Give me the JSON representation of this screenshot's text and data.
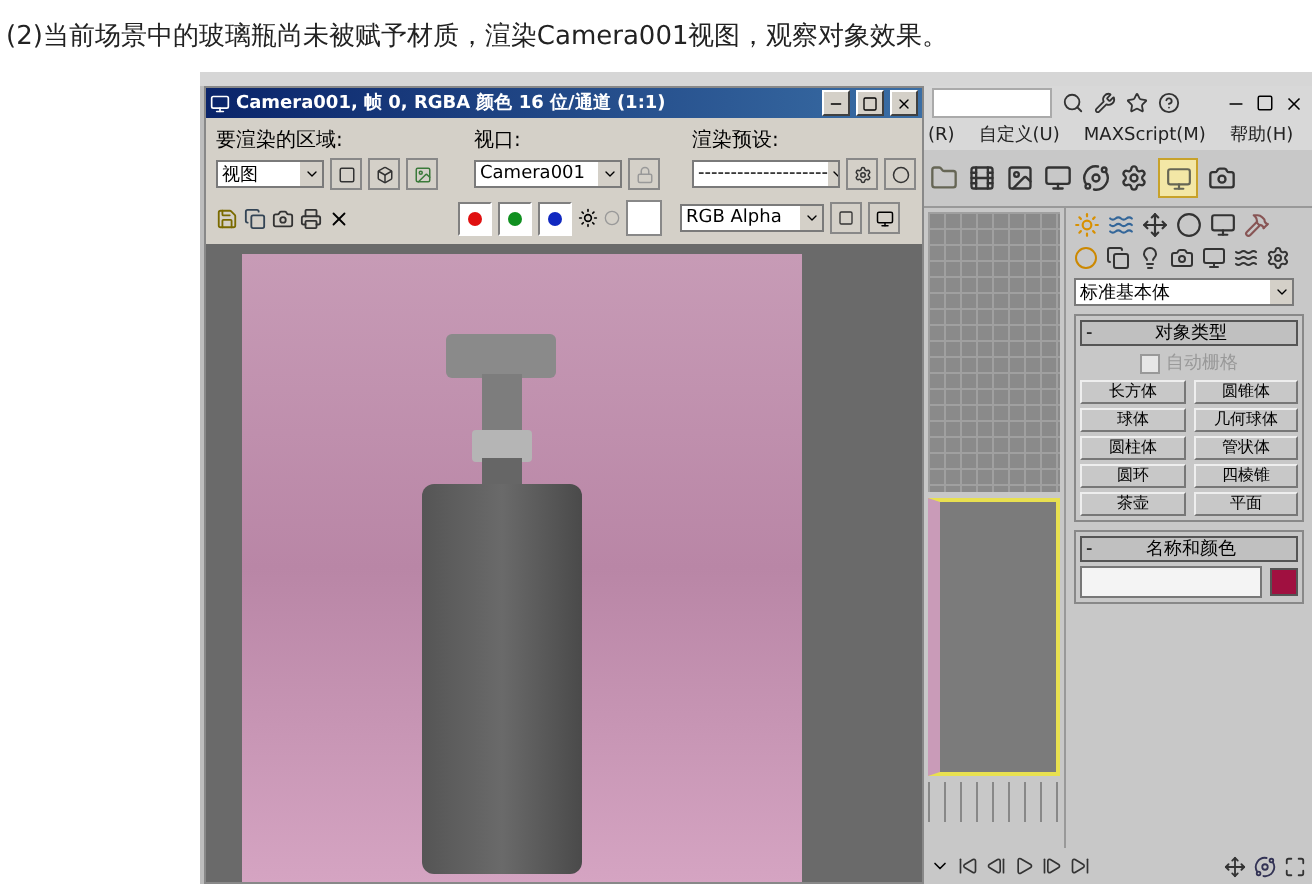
{
  "caption": "(2)当前场景中的玻璃瓶尚未被赋予材质，渲染Camera001视图，观察对象效果。",
  "render_window": {
    "title": "Camera001, 帧 0, RGBA 颜色 16 位/通道 (1:1)",
    "area_label": "要渲染的区域:",
    "area_value": "视图",
    "viewport_label": "视口:",
    "viewport_value": "Camera001",
    "preset_label": "渲染预设:",
    "preset_value": "--------------------",
    "channels": [
      {
        "color": "#e01010",
        "on": true
      },
      {
        "color": "#109020",
        "on": true
      },
      {
        "color": "#1028c0",
        "on": true
      }
    ],
    "display_value": "RGB Alpha"
  },
  "max_window": {
    "menu": [
      "(R)",
      "自定义(U)",
      "MAXScript(M)",
      "帮助(H)"
    ],
    "command_panel": {
      "category": "标准基本体",
      "object_type": {
        "collapse": "-",
        "title": "对象类型",
        "autogrid": {
          "label": "自动栅格",
          "checked": false,
          "disabled": true
        },
        "buttons": [
          "长方体",
          "圆锥体",
          "球体",
          "几何球体",
          "圆柱体",
          "管状体",
          "圆环",
          "四棱锥",
          "茶壶",
          "平面"
        ]
      },
      "name_color": {
        "collapse": "-",
        "title": "名称和颜色",
        "color": "#a01040"
      }
    }
  }
}
